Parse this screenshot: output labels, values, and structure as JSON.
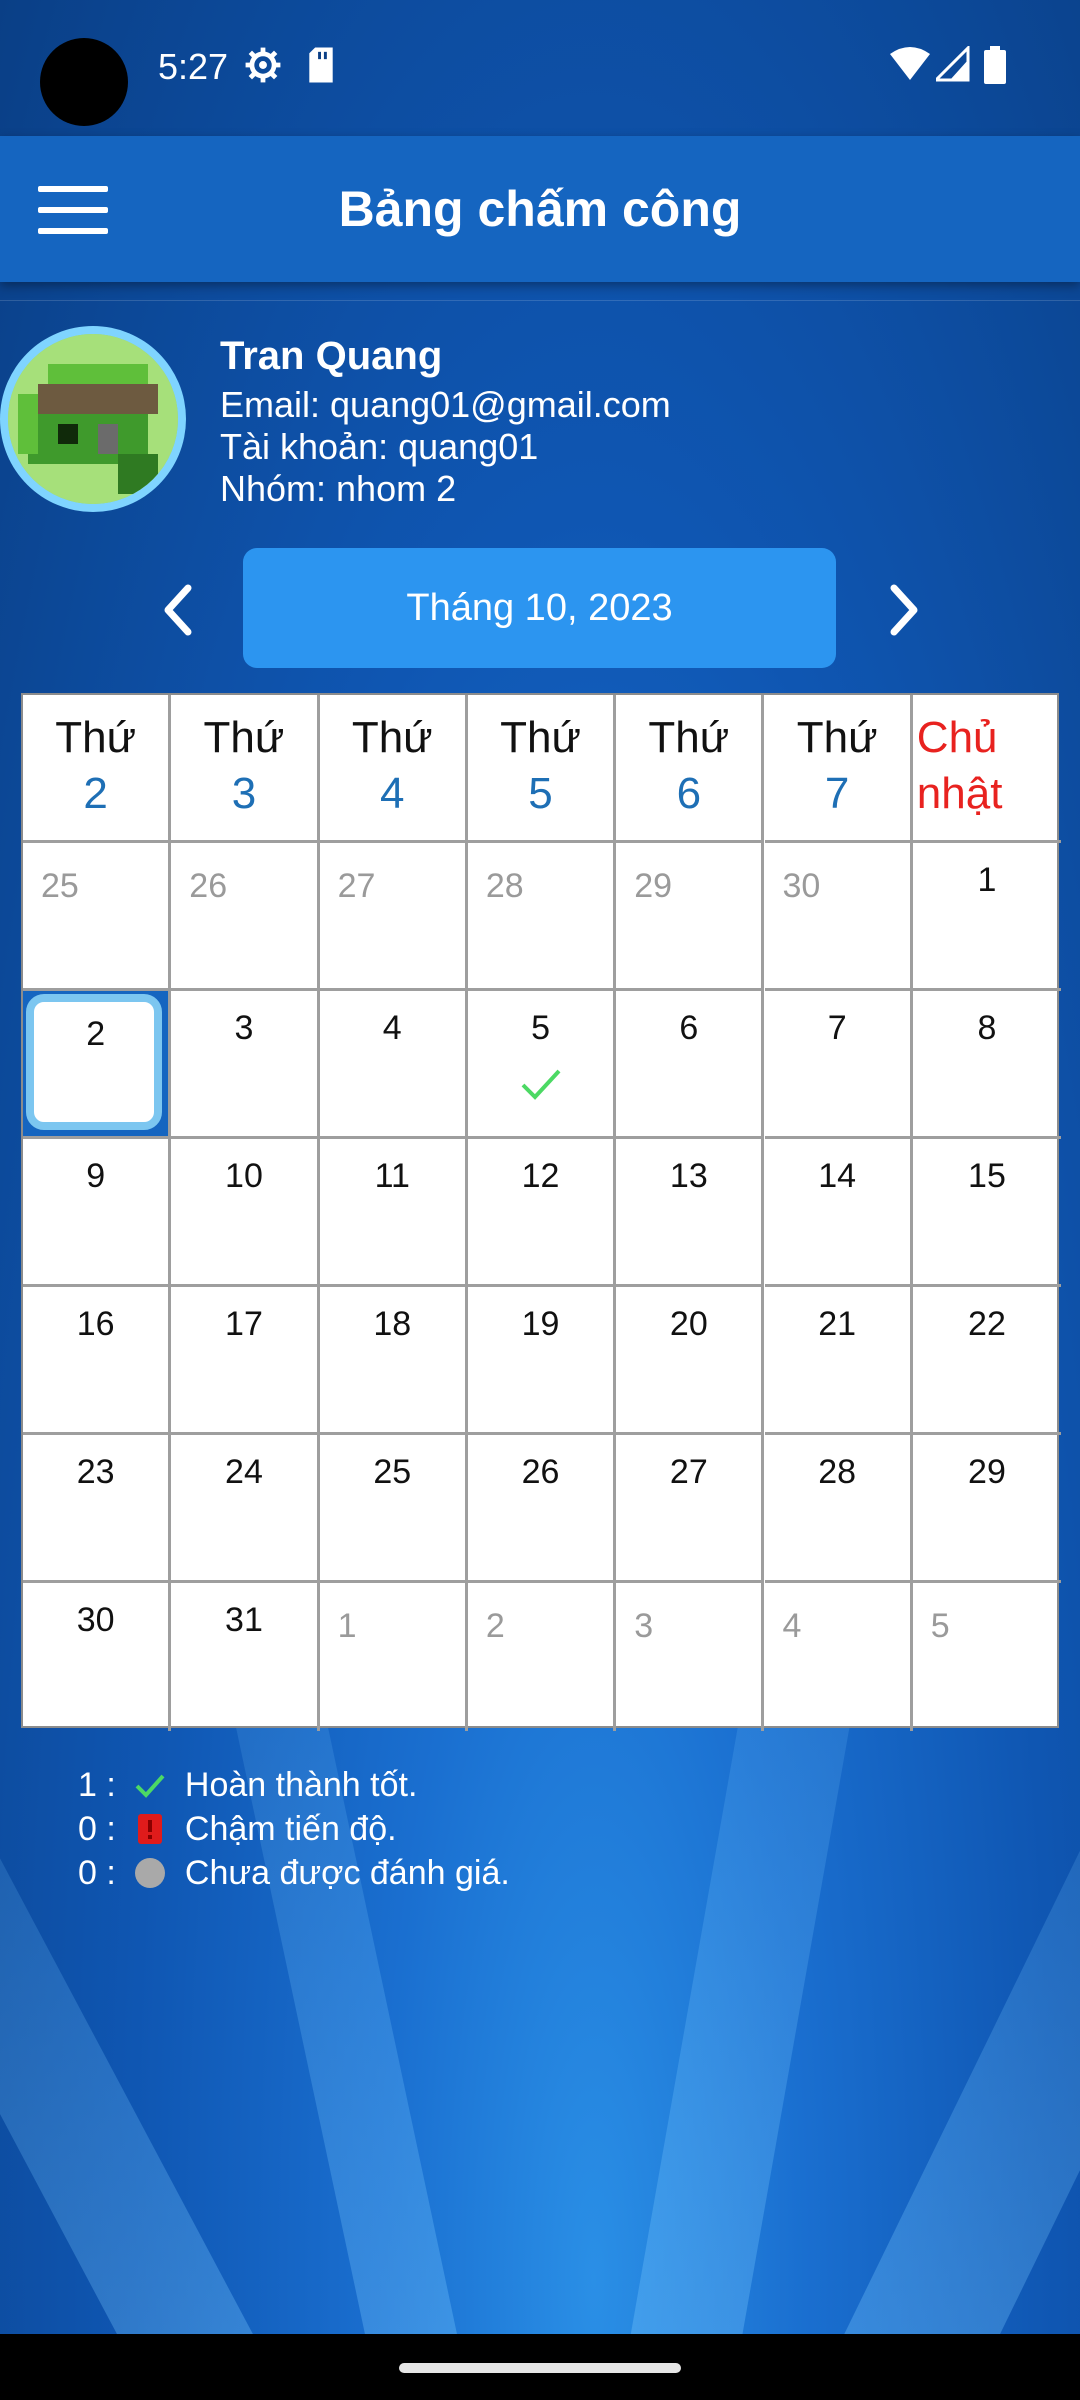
{
  "status_bar": {
    "time": "5:27",
    "icons": [
      "settings-icon",
      "sd-card-icon",
      "wifi-icon",
      "signal-icon",
      "battery-icon"
    ]
  },
  "app_bar": {
    "title": "Bảng chấm công",
    "menu_icon": "hamburger-menu-icon"
  },
  "user": {
    "name": "Tran Quang",
    "email": "Email: quang01@gmail.com",
    "account": "Tài khoản: quang01",
    "group": "Nhóm: nhom 2"
  },
  "month_nav": {
    "label": "Tháng 10, 2023",
    "prev_icon": "chevron-left-icon",
    "next_icon": "chevron-right-icon"
  },
  "calendar": {
    "weekdays": [
      {
        "line1": "Thứ",
        "line2": "2"
      },
      {
        "line1": "Thứ",
        "line2": "3"
      },
      {
        "line1": "Thứ",
        "line2": "4"
      },
      {
        "line1": "Thứ",
        "line2": "5"
      },
      {
        "line1": "Thứ",
        "line2": "6"
      },
      {
        "line1": "Thứ",
        "line2": "7"
      },
      {
        "line1": "Chủ",
        "line2": "nhật"
      }
    ],
    "weeks": [
      [
        "25",
        "26",
        "27",
        "28",
        "29",
        "30",
        "1"
      ],
      [
        "2",
        "3",
        "4",
        "5",
        "6",
        "7",
        "8"
      ],
      [
        "9",
        "10",
        "11",
        "12",
        "13",
        "14",
        "15"
      ],
      [
        "16",
        "17",
        "18",
        "19",
        "20",
        "21",
        "22"
      ],
      [
        "23",
        "24",
        "25",
        "26",
        "27",
        "28",
        "29"
      ],
      [
        "30",
        "31",
        "1",
        "2",
        "3",
        "4",
        "5"
      ]
    ],
    "selected_day": "2",
    "marked_good_day": "5"
  },
  "legend": [
    {
      "count": "1 :",
      "icon": "check-icon",
      "label": "Hoàn thành tốt."
    },
    {
      "count": "0 :",
      "icon": "red-flag-icon",
      "label": "Chậm tiến độ."
    },
    {
      "count": "0 :",
      "icon": "gray-circle-icon",
      "label": "Chưa được đánh giá."
    }
  ],
  "colors": {
    "app_bar": "#1565c0",
    "month_button": "#2c95f0",
    "weekday_number": "#1e6fb5",
    "sunday": "#e8221f",
    "check": "#4cd964",
    "selected_border": "#7cc6f0"
  }
}
